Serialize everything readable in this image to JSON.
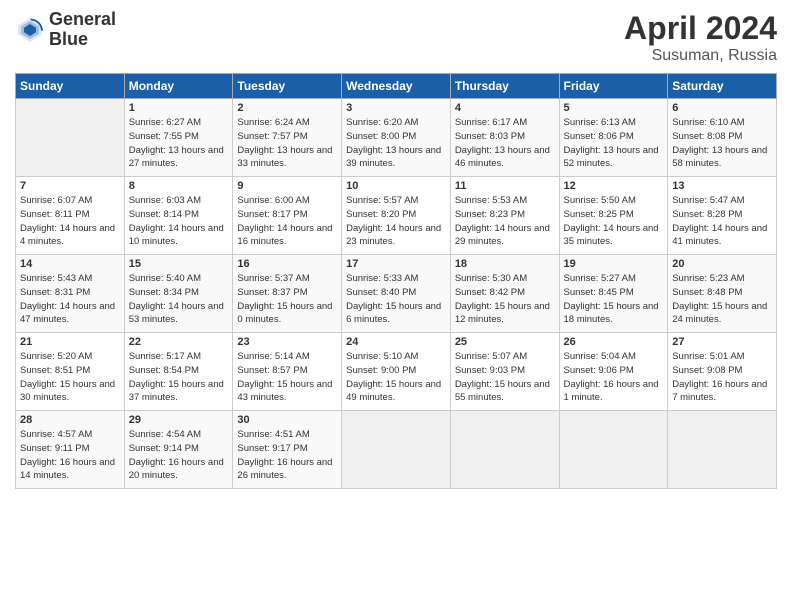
{
  "header": {
    "logo_line1": "General",
    "logo_line2": "Blue",
    "month": "April 2024",
    "location": "Susuman, Russia"
  },
  "days_of_week": [
    "Sunday",
    "Monday",
    "Tuesday",
    "Wednesday",
    "Thursday",
    "Friday",
    "Saturday"
  ],
  "weeks": [
    [
      {
        "day": "",
        "empty": true
      },
      {
        "day": "1",
        "sunrise": "Sunrise: 6:27 AM",
        "sunset": "Sunset: 7:55 PM",
        "daylight": "Daylight: 13 hours and 27 minutes."
      },
      {
        "day": "2",
        "sunrise": "Sunrise: 6:24 AM",
        "sunset": "Sunset: 7:57 PM",
        "daylight": "Daylight: 13 hours and 33 minutes."
      },
      {
        "day": "3",
        "sunrise": "Sunrise: 6:20 AM",
        "sunset": "Sunset: 8:00 PM",
        "daylight": "Daylight: 13 hours and 39 minutes."
      },
      {
        "day": "4",
        "sunrise": "Sunrise: 6:17 AM",
        "sunset": "Sunset: 8:03 PM",
        "daylight": "Daylight: 13 hours and 46 minutes."
      },
      {
        "day": "5",
        "sunrise": "Sunrise: 6:13 AM",
        "sunset": "Sunset: 8:06 PM",
        "daylight": "Daylight: 13 hours and 52 minutes."
      },
      {
        "day": "6",
        "sunrise": "Sunrise: 6:10 AM",
        "sunset": "Sunset: 8:08 PM",
        "daylight": "Daylight: 13 hours and 58 minutes."
      }
    ],
    [
      {
        "day": "7",
        "sunrise": "Sunrise: 6:07 AM",
        "sunset": "Sunset: 8:11 PM",
        "daylight": "Daylight: 14 hours and 4 minutes."
      },
      {
        "day": "8",
        "sunrise": "Sunrise: 6:03 AM",
        "sunset": "Sunset: 8:14 PM",
        "daylight": "Daylight: 14 hours and 10 minutes."
      },
      {
        "day": "9",
        "sunrise": "Sunrise: 6:00 AM",
        "sunset": "Sunset: 8:17 PM",
        "daylight": "Daylight: 14 hours and 16 minutes."
      },
      {
        "day": "10",
        "sunrise": "Sunrise: 5:57 AM",
        "sunset": "Sunset: 8:20 PM",
        "daylight": "Daylight: 14 hours and 23 minutes."
      },
      {
        "day": "11",
        "sunrise": "Sunrise: 5:53 AM",
        "sunset": "Sunset: 8:23 PM",
        "daylight": "Daylight: 14 hours and 29 minutes."
      },
      {
        "day": "12",
        "sunrise": "Sunrise: 5:50 AM",
        "sunset": "Sunset: 8:25 PM",
        "daylight": "Daylight: 14 hours and 35 minutes."
      },
      {
        "day": "13",
        "sunrise": "Sunrise: 5:47 AM",
        "sunset": "Sunset: 8:28 PM",
        "daylight": "Daylight: 14 hours and 41 minutes."
      }
    ],
    [
      {
        "day": "14",
        "sunrise": "Sunrise: 5:43 AM",
        "sunset": "Sunset: 8:31 PM",
        "daylight": "Daylight: 14 hours and 47 minutes."
      },
      {
        "day": "15",
        "sunrise": "Sunrise: 5:40 AM",
        "sunset": "Sunset: 8:34 PM",
        "daylight": "Daylight: 14 hours and 53 minutes."
      },
      {
        "day": "16",
        "sunrise": "Sunrise: 5:37 AM",
        "sunset": "Sunset: 8:37 PM",
        "daylight": "Daylight: 15 hours and 0 minutes."
      },
      {
        "day": "17",
        "sunrise": "Sunrise: 5:33 AM",
        "sunset": "Sunset: 8:40 PM",
        "daylight": "Daylight: 15 hours and 6 minutes."
      },
      {
        "day": "18",
        "sunrise": "Sunrise: 5:30 AM",
        "sunset": "Sunset: 8:42 PM",
        "daylight": "Daylight: 15 hours and 12 minutes."
      },
      {
        "day": "19",
        "sunrise": "Sunrise: 5:27 AM",
        "sunset": "Sunset: 8:45 PM",
        "daylight": "Daylight: 15 hours and 18 minutes."
      },
      {
        "day": "20",
        "sunrise": "Sunrise: 5:23 AM",
        "sunset": "Sunset: 8:48 PM",
        "daylight": "Daylight: 15 hours and 24 minutes."
      }
    ],
    [
      {
        "day": "21",
        "sunrise": "Sunrise: 5:20 AM",
        "sunset": "Sunset: 8:51 PM",
        "daylight": "Daylight: 15 hours and 30 minutes."
      },
      {
        "day": "22",
        "sunrise": "Sunrise: 5:17 AM",
        "sunset": "Sunset: 8:54 PM",
        "daylight": "Daylight: 15 hours and 37 minutes."
      },
      {
        "day": "23",
        "sunrise": "Sunrise: 5:14 AM",
        "sunset": "Sunset: 8:57 PM",
        "daylight": "Daylight: 15 hours and 43 minutes."
      },
      {
        "day": "24",
        "sunrise": "Sunrise: 5:10 AM",
        "sunset": "Sunset: 9:00 PM",
        "daylight": "Daylight: 15 hours and 49 minutes."
      },
      {
        "day": "25",
        "sunrise": "Sunrise: 5:07 AM",
        "sunset": "Sunset: 9:03 PM",
        "daylight": "Daylight: 15 hours and 55 minutes."
      },
      {
        "day": "26",
        "sunrise": "Sunrise: 5:04 AM",
        "sunset": "Sunset: 9:06 PM",
        "daylight": "Daylight: 16 hours and 1 minute."
      },
      {
        "day": "27",
        "sunrise": "Sunrise: 5:01 AM",
        "sunset": "Sunset: 9:08 PM",
        "daylight": "Daylight: 16 hours and 7 minutes."
      }
    ],
    [
      {
        "day": "28",
        "sunrise": "Sunrise: 4:57 AM",
        "sunset": "Sunset: 9:11 PM",
        "daylight": "Daylight: 16 hours and 14 minutes."
      },
      {
        "day": "29",
        "sunrise": "Sunrise: 4:54 AM",
        "sunset": "Sunset: 9:14 PM",
        "daylight": "Daylight: 16 hours and 20 minutes."
      },
      {
        "day": "30",
        "sunrise": "Sunrise: 4:51 AM",
        "sunset": "Sunset: 9:17 PM",
        "daylight": "Daylight: 16 hours and 26 minutes."
      },
      {
        "day": "",
        "empty": true
      },
      {
        "day": "",
        "empty": true
      },
      {
        "day": "",
        "empty": true
      },
      {
        "day": "",
        "empty": true
      }
    ]
  ]
}
